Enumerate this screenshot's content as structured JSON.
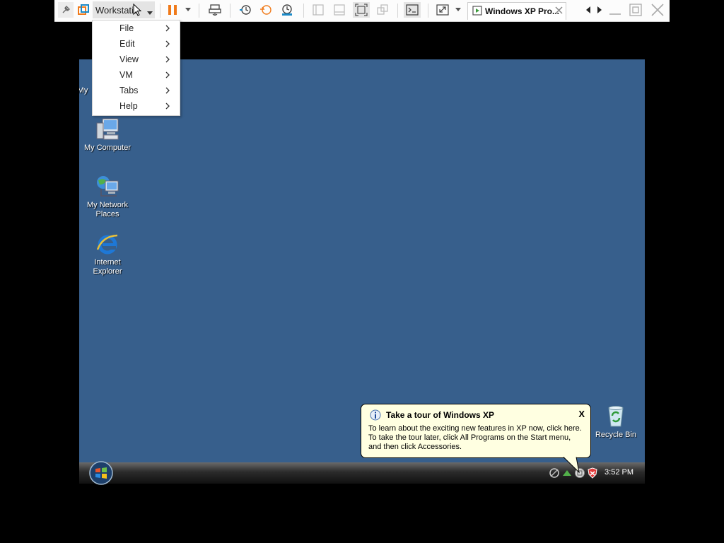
{
  "toolbar": {
    "workstation_label": "Workstation",
    "tab_title": "Windows XP Pro..."
  },
  "menu": {
    "items": [
      {
        "label": "File"
      },
      {
        "label": "Edit"
      },
      {
        "label": "View"
      },
      {
        "label": "VM"
      },
      {
        "label": "Tabs"
      },
      {
        "label": "Help"
      }
    ]
  },
  "desktop": {
    "partial_icon_label": "My",
    "icons": [
      {
        "label": "My Computer"
      },
      {
        "label": "My Network Places"
      },
      {
        "label": "Internet Explorer"
      },
      {
        "label": "Recycle Bin"
      }
    ]
  },
  "balloon": {
    "title": "Take a tour of Windows XP",
    "line1": "To learn about the exciting new features in XP now, click here.",
    "line2": "To take the tour later, click All Programs on the Start menu,",
    "line3": "and then click Accessories.",
    "close_glyph": "X"
  },
  "taskbar": {
    "clock": "3:52 PM"
  },
  "colors": {
    "desktop_bg": "#375f8c",
    "pause_orange": "#f07a1a",
    "balloon_bg": "#ffffe1"
  }
}
